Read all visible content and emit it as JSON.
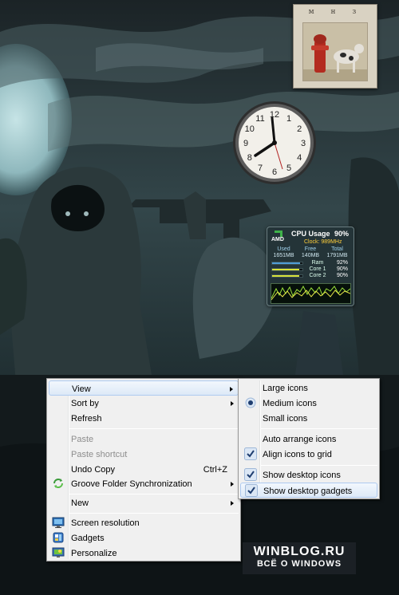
{
  "main_menu": {
    "items": [
      {
        "label": "View",
        "submenu": true,
        "highlighted": true
      },
      {
        "label": "Sort by",
        "submenu": true
      },
      {
        "label": "Refresh"
      },
      {
        "label": "Paste",
        "disabled": true
      },
      {
        "label": "Paste shortcut",
        "disabled": true
      },
      {
        "label": "Undo Copy",
        "shortcut": "Ctrl+Z"
      },
      {
        "label": "Groove Folder Synchronization",
        "submenu": true,
        "icon": "groove-sync-icon"
      },
      {
        "label": "New",
        "submenu": true
      },
      {
        "label": "Screen resolution",
        "icon": "screen-resolution-icon"
      },
      {
        "label": "Gadgets",
        "icon": "gadgets-icon"
      },
      {
        "label": "Personalize",
        "icon": "personalize-icon"
      }
    ]
  },
  "view_submenu": {
    "items": [
      {
        "label": "Large icons"
      },
      {
        "label": "Medium icons",
        "selected": true
      },
      {
        "label": "Small icons"
      },
      {
        "label": "Auto arrange icons"
      },
      {
        "label": "Align icons to grid",
        "checked": true
      },
      {
        "label": "Show desktop icons",
        "checked": true
      },
      {
        "label": "Show desktop gadgets",
        "checked": true,
        "highlighted": true
      }
    ]
  },
  "cpu_gadget": {
    "brand": "AMD",
    "title": "CPU Usage",
    "usage": "90%",
    "clock": "Clock: 989MHz",
    "mem_headers": [
      "Used",
      "Free",
      "Total"
    ],
    "mem_values": [
      "1651MB",
      "140MB",
      "1791MB"
    ],
    "bars": [
      {
        "label": "Ram",
        "pct": "92%",
        "fraction": 0.92
      },
      {
        "label": "Core 1",
        "pct": "90%",
        "fraction": 0.9
      },
      {
        "label": "Core 2",
        "pct": "90%",
        "fraction": 0.9
      }
    ]
  },
  "clock_gadget": {
    "numbers": [
      "12",
      "1",
      "2",
      "3",
      "4",
      "5",
      "6",
      "7",
      "8",
      "9",
      "10",
      "11"
    ]
  },
  "photo_gadget": {
    "caption": "м н з"
  },
  "watermark": {
    "line1": "WINBLOG.RU",
    "line2": "ВСЁ О WINDOWS"
  },
  "colors": {
    "menu_bg": "#f0f0f0",
    "highlight": "#dde9f7",
    "highlight_border": "#aecaf0",
    "disabled_text": "#8d8d8d",
    "bar_ram": "#4f9dd6",
    "bar_core": "#d8e23a"
  }
}
